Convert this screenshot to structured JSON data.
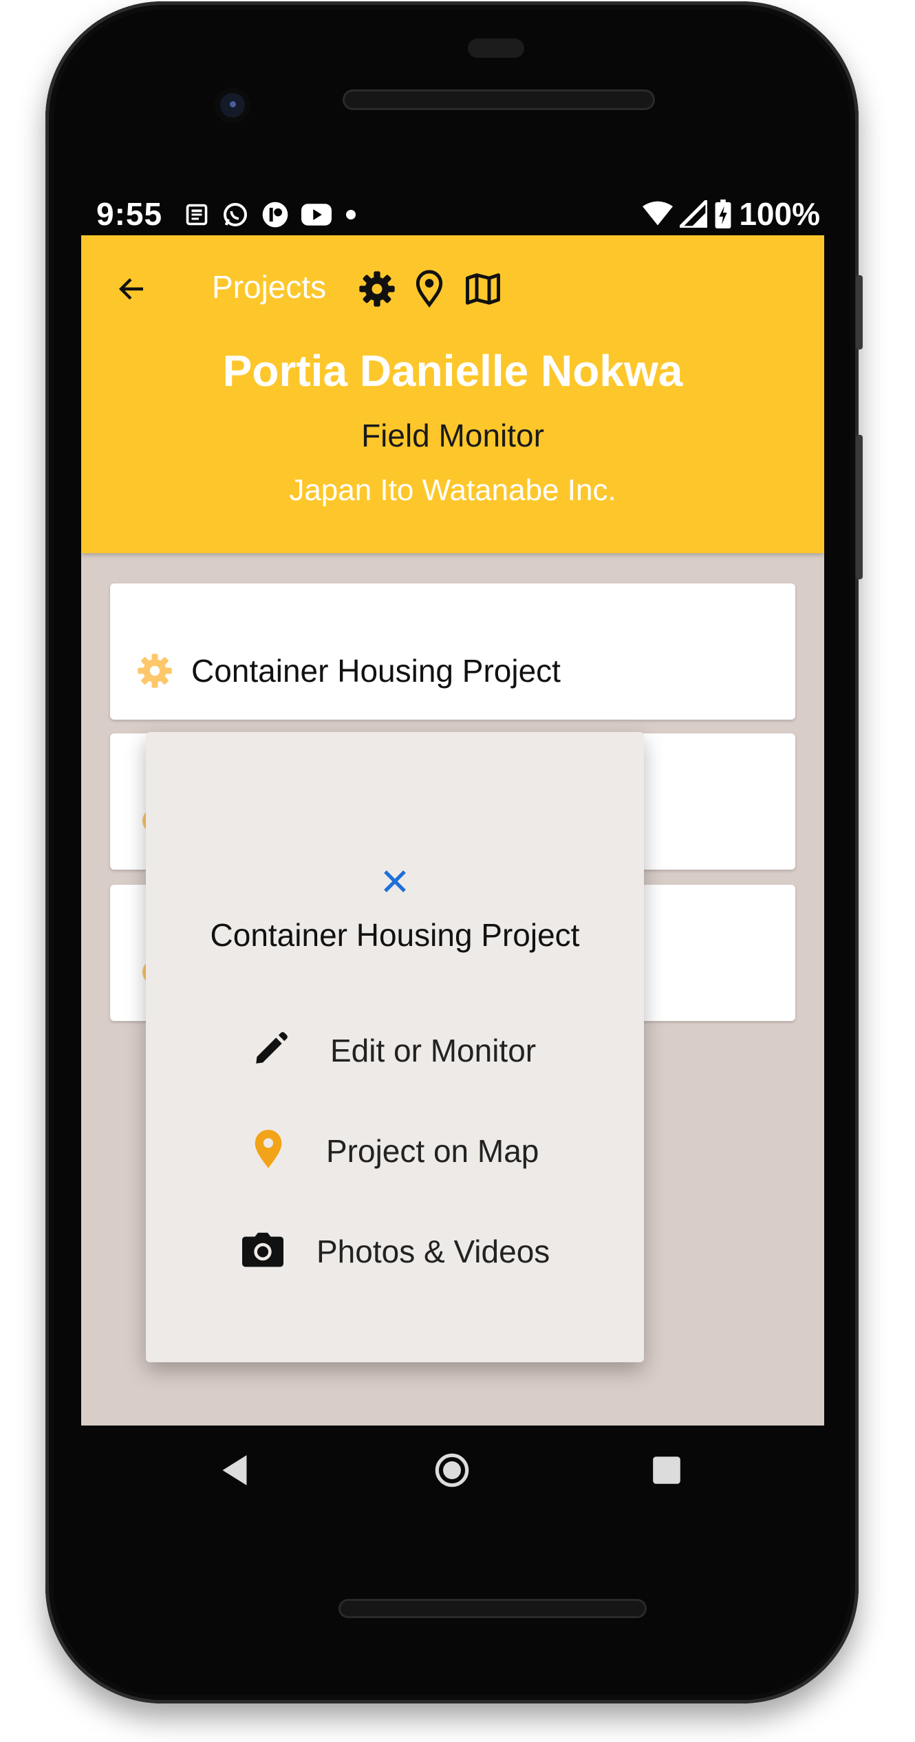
{
  "status_bar": {
    "time": "9:55",
    "battery": "100%",
    "icons": [
      "news-icon",
      "whatsapp-icon",
      "app-icon",
      "youtube-icon",
      "dot-icon",
      "wifi-icon",
      "signal-icon",
      "battery-charging-icon"
    ]
  },
  "appbar": {
    "title": "Projects",
    "actions": [
      "settings-icon",
      "location-pin-icon",
      "map-icon"
    ]
  },
  "profile": {
    "name": "Portia Danielle Nokwa",
    "role": "Field Monitor",
    "company": "Japan Ito Watanabe Inc."
  },
  "projects": [
    {
      "label": "Container Housing Project"
    },
    {
      "label": ""
    },
    {
      "label": ""
    }
  ],
  "dialog": {
    "title": "Container Housing Project",
    "items": [
      {
        "label": "Edit or Monitor",
        "icon": "pencil-icon"
      },
      {
        "label": "Project on Map",
        "icon": "location-pin-icon"
      },
      {
        "label": "Photos & Videos",
        "icon": "camera-icon"
      }
    ]
  },
  "colors": {
    "appbar": "#fdc72b",
    "background": "#d9cdc8",
    "dialog": "#eeeae7",
    "close": "#1e6fd9",
    "pin": "#f2a318",
    "gear": "#fdc76a"
  }
}
